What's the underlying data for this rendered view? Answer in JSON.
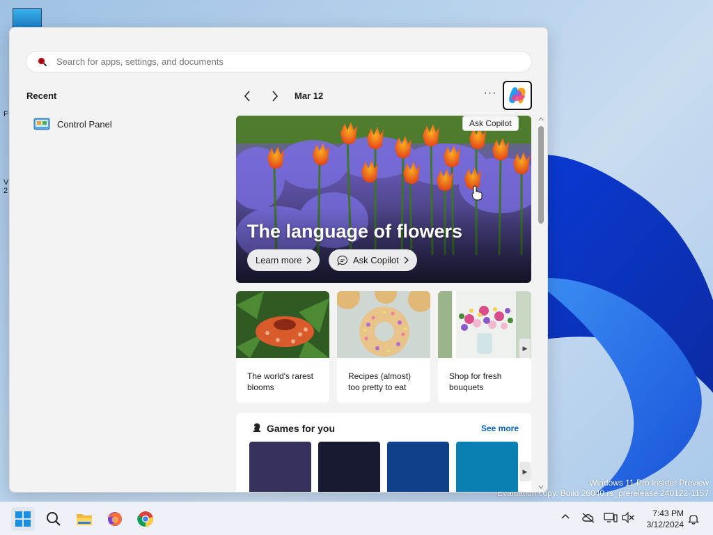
{
  "start": {
    "search_placeholder": "Search for apps, settings, and documents",
    "recent_title": "Recent",
    "recent_items": [
      {
        "label": "Control Panel",
        "icon": "control-panel-icon"
      }
    ],
    "date": "Mar 12",
    "copilot_tooltip": "Ask Copilot",
    "hero": {
      "title": "The language of flowers",
      "learn_more": "Learn more",
      "ask_copilot": "Ask Copilot"
    },
    "cards": [
      {
        "caption": "The world's rarest blooms"
      },
      {
        "caption": "Recipes (almost) too pretty to eat"
      },
      {
        "caption": "Shop for fresh bouquets"
      }
    ],
    "games": {
      "title": "Games for you",
      "see_more": "See more",
      "tile_colors": [
        "#34325a",
        "#171a32",
        "#10408a",
        "#0a7fb3"
      ]
    }
  },
  "watermark": {
    "line1": "Windows 11 Pro Insider Preview",
    "line2": "Evaluation copy. Build 26040.rs_prerelease.240122-1157"
  },
  "taskbar": {
    "time": "7:43 PM",
    "date": "3/12/2024"
  },
  "colors": {
    "accent": "#005fb8",
    "panel": "#f3f3f3"
  }
}
